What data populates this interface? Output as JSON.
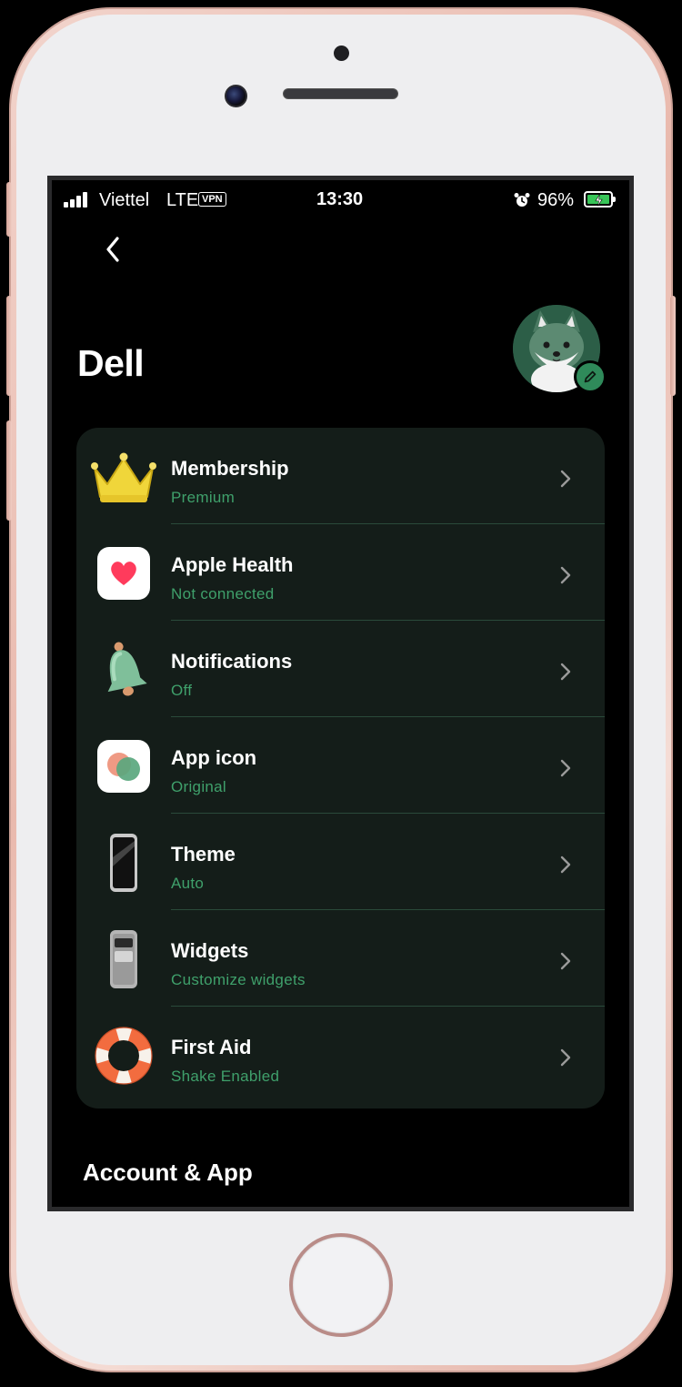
{
  "status_bar": {
    "carrier": "Viettel",
    "network": "LTE",
    "vpn": "VPN",
    "time": "13:30",
    "battery": "96%"
  },
  "header": {
    "title": "Dell"
  },
  "settings": [
    {
      "title": "Membership",
      "subtitle": "Premium",
      "icon": "crown-icon"
    },
    {
      "title": "Apple Health",
      "subtitle": "Not connected",
      "icon": "apple-health-icon"
    },
    {
      "title": "Notifications",
      "subtitle": "Off",
      "icon": "bell-icon"
    },
    {
      "title": "App icon",
      "subtitle": "Original",
      "icon": "app-icon-icon"
    },
    {
      "title": "Theme",
      "subtitle": "Auto",
      "icon": "phone-theme-icon"
    },
    {
      "title": "Widgets",
      "subtitle": "Customize widgets",
      "icon": "widgets-icon"
    },
    {
      "title": "First Aid",
      "subtitle": "Shake Enabled",
      "icon": "lifebuoy-icon"
    }
  ],
  "sections": {
    "account": "Account & App"
  },
  "colors": {
    "background": "#000000",
    "card": "#141d19",
    "subtitle": "#3fa06b",
    "accent": "#2f8a5a"
  }
}
